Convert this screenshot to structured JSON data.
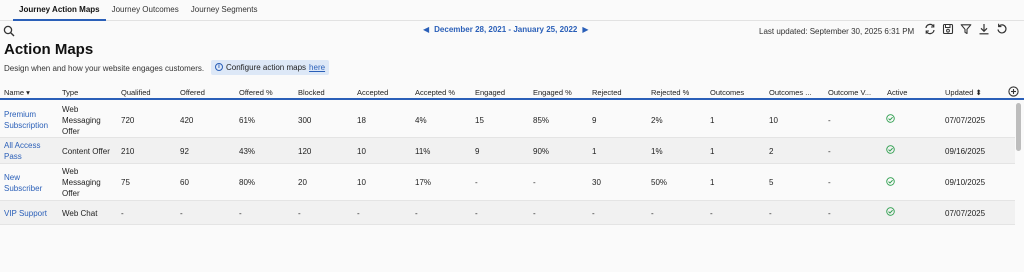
{
  "tabs": [
    "Journey Action Maps",
    "Journey Outcomes",
    "Journey Segments"
  ],
  "toolbar": {
    "date_range": "December 28, 2021 - January 25, 2022",
    "last_updated": "Last updated: September 30, 2025 6:31 PM"
  },
  "header": {
    "title": "Action Maps",
    "subtitle": "Design when and how your website engages customers.",
    "info_text": "Configure action maps",
    "info_link": "here"
  },
  "table": {
    "columns": [
      "Name",
      "Type",
      "Qualified",
      "Offered",
      "Offered %",
      "Blocked",
      "Accepted",
      "Accepted %",
      "Engaged",
      "Engaged %",
      "Rejected",
      "Rejected %",
      "Outcomes",
      "Outcomes ...",
      "Outcome V...",
      "Active",
      "Updated"
    ],
    "rows": [
      {
        "name": [
          "Premium",
          "Subscription"
        ],
        "type": [
          "Web",
          "Messaging",
          "Offer"
        ],
        "qualified": "720",
        "offered": "420",
        "offered_pct": "61%",
        "blocked": "300",
        "accepted": "18",
        "accepted_pct": "4%",
        "engaged": "15",
        "engaged_pct": "85%",
        "rejected": "9",
        "rejected_pct": "2%",
        "outcomes": "1",
        "outcomes2": "10",
        "outcome_v": "-",
        "updated": "07/07/2025"
      },
      {
        "name": [
          "All Access",
          "Pass"
        ],
        "type": [
          "Content Offer"
        ],
        "qualified": "210",
        "offered": "92",
        "offered_pct": "43%",
        "blocked": "120",
        "accepted": "10",
        "accepted_pct": "11%",
        "engaged": "9",
        "engaged_pct": "90%",
        "rejected": "1",
        "rejected_pct": "1%",
        "outcomes": "1",
        "outcomes2": "2",
        "outcome_v": "-",
        "updated": "09/16/2025"
      },
      {
        "name": [
          "New",
          "Subscriber"
        ],
        "type": [
          "Web",
          "Messaging",
          "Offer"
        ],
        "qualified": "75",
        "offered": "60",
        "offered_pct": "80%",
        "blocked": "20",
        "accepted": "10",
        "accepted_pct": "17%",
        "engaged": "-",
        "engaged_pct": "-",
        "rejected": "30",
        "rejected_pct": "50%",
        "outcomes": "1",
        "outcomes2": "5",
        "outcome_v": "-",
        "updated": "09/10/2025"
      },
      {
        "name": [
          "VIP Support"
        ],
        "type": [
          "Web Chat"
        ],
        "qualified": "-",
        "offered": "-",
        "offered_pct": "-",
        "blocked": "-",
        "accepted": "-",
        "accepted_pct": "-",
        "engaged": "-",
        "engaged_pct": "-",
        "rejected": "-",
        "rejected_pct": "-",
        "outcomes": "-",
        "outcomes2": "-",
        "outcome_v": "-",
        "updated": "07/07/2025"
      }
    ]
  },
  "icons": {
    "search": "search-icon",
    "prev": "arrow-left-icon",
    "next": "arrow-right-icon",
    "refresh": "refresh-icon",
    "save": "save-icon",
    "filter": "filter-icon",
    "download": "download-icon",
    "reset": "reset-icon",
    "add_column": "plus-circle-icon",
    "active": "check-circle-icon",
    "sort": "sort-icon"
  },
  "colors": {
    "accent": "#2a5fb8",
    "active_check": "#2e9e4e",
    "info_bg": "#dde8f7"
  }
}
